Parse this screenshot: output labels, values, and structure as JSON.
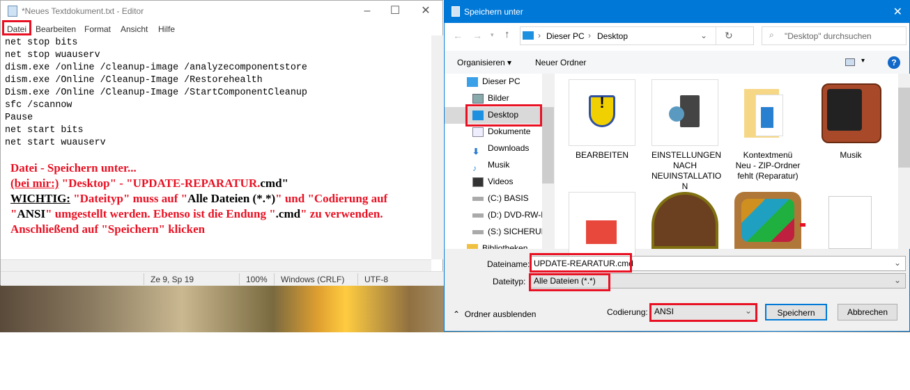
{
  "notepad": {
    "title": "*Neues Textdokument.txt - Editor",
    "menu": [
      "Datei",
      "Bearbeiten",
      "Format",
      "Ansicht",
      "Hilfe"
    ],
    "lines": [
      "net stop bits",
      "net stop wuauserv",
      "dism.exe /online /cleanup-image /analyzecomponentstore",
      "dism.exe /Online /Cleanup-Image /Restorehealth",
      "Dism.exe /Online /Cleanup-Image /StartComponentCleanup",
      "sfc /scannow",
      "Pause",
      "net start bits",
      "net start wuauserv"
    ],
    "note": {
      "l1": "Datei - Speichern unter...",
      "l2a": "(bei mir:)",
      "l2b": " \"Desktop\" - \"UPDATE-REPARATUR.",
      "l2c": "cmd\"",
      "l3a": "WICHTIG:",
      "l3b": " \"Dateityp\" muss auf \"",
      "l3c": "Alle Dateien (*.*)",
      "l3d": "\" und \"Codierung auf \"",
      "l3e": "ANSI",
      "l3f": "\" umgestellt werden. Ebenso ist die Endung \"",
      "l3g": ".cmd",
      "l3h": "\" zu verwenden.",
      "l4": "Anschließend auf \"Speichern\" klicken"
    },
    "status": {
      "pos": "Ze 9, Sp 19",
      "zoom": "100%",
      "eol": "Windows (CRLF)",
      "enc": "UTF-8"
    }
  },
  "dialog": {
    "title": "Speichern unter",
    "breadcrumb": [
      "Dieser PC",
      "Desktop"
    ],
    "search_placeholder": "\"Desktop\" durchsuchen",
    "toolbar": {
      "organize": "Organisieren",
      "new_folder": "Neuer Ordner"
    },
    "nav": [
      "Dieser PC",
      "Bilder",
      "Desktop",
      "Dokumente",
      "Downloads",
      "Musik",
      "Videos",
      "(C:) BASIS",
      "(D:) DVD-RW-L",
      "(S:) SICHERUNG",
      "Bibliotheken"
    ],
    "files": [
      "BEARBEITEN",
      "EINSTELLUNGEN NACH NEUINSTALLATIO N",
      "Kontextmenü Neu - ZIP-Ordner fehlt (Reparatur)",
      "Musik"
    ],
    "filename_label": "Dateiname:",
    "filename": "UPDATE-REARATUR.cmd",
    "filetype_label": "Dateityp:",
    "filetype": "Alle Dateien  (*.*)",
    "hide_folders": "Ordner ausblenden",
    "encoding_label": "Codierung:",
    "encoding": "ANSI",
    "save": "Speichern",
    "cancel": "Abbrechen"
  },
  "colors": {
    "accent": "#0078d7",
    "highlight": "#e81123"
  }
}
